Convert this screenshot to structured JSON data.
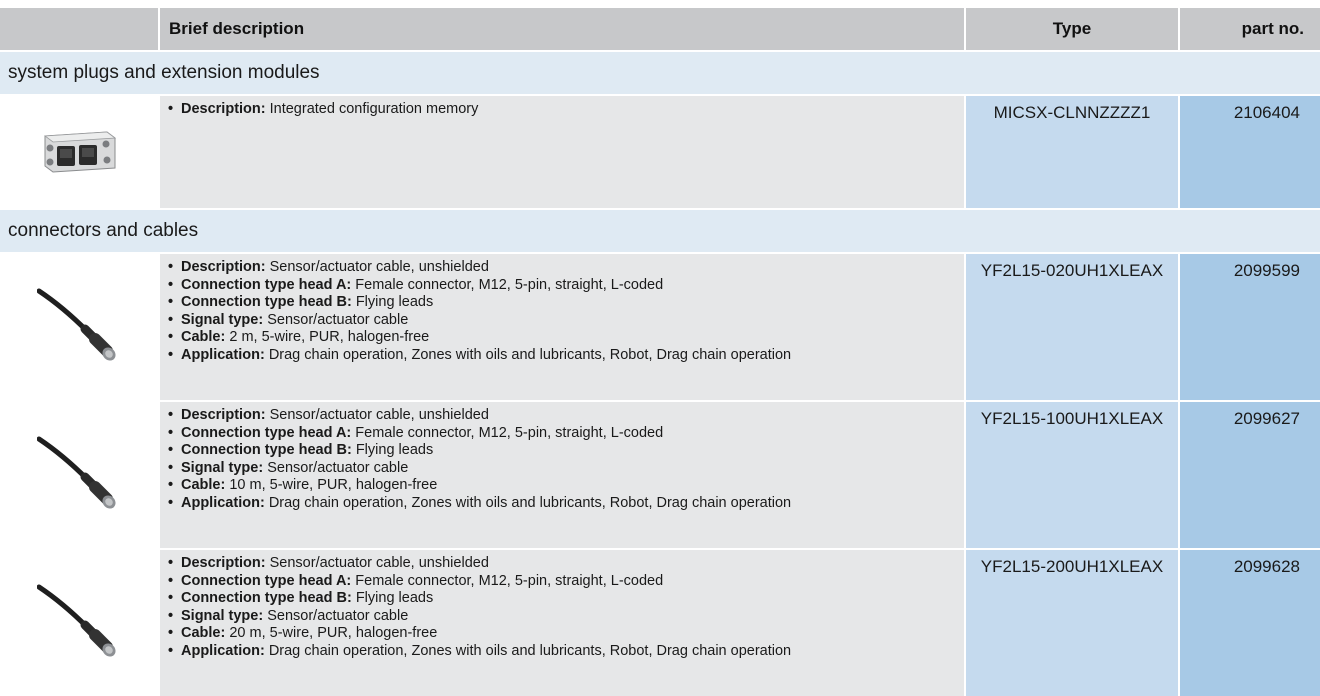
{
  "table": {
    "columns": {
      "brief_description": "Brief description",
      "type": "Type",
      "part_no": "part no."
    },
    "groups": [
      {
        "title": "system plugs and extension modules",
        "items": [
          {
            "image": "system-plug-module-image",
            "features": [
              {
                "label": "Description:",
                "value": "Integrated configuration memory"
              }
            ],
            "type": "MICSX-CLNNZZZZ1",
            "part_no": "2106404"
          }
        ]
      },
      {
        "title": "connectors and cables",
        "items": [
          {
            "image": "cable-connector-image",
            "features": [
              {
                "label": "Description:",
                "value": "Sensor/actuator cable, unshielded"
              },
              {
                "label": "Connection type head A:",
                "value": "Female connector, M12, 5-pin, straight, L-coded"
              },
              {
                "label": "Connection type head B:",
                "value": "Flying leads"
              },
              {
                "label": "Signal type:",
                "value": "Sensor/actuator cable"
              },
              {
                "label": "Cable:",
                "value": "2 m, 5-wire, PUR, halogen-free"
              },
              {
                "label": "Application:",
                "value": "Drag chain operation, Zones with oils and lubricants, Robot, Drag chain operation"
              }
            ],
            "type": "YF2L15-020UH1XLEAX",
            "part_no": "2099599"
          },
          {
            "image": "cable-connector-image",
            "features": [
              {
                "label": "Description:",
                "value": "Sensor/actuator cable, unshielded"
              },
              {
                "label": "Connection type head A:",
                "value": "Female connector, M12, 5-pin, straight, L-coded"
              },
              {
                "label": "Connection type head B:",
                "value": "Flying leads"
              },
              {
                "label": "Signal type:",
                "value": "Sensor/actuator cable"
              },
              {
                "label": "Cable:",
                "value": "10 m, 5-wire, PUR, halogen-free"
              },
              {
                "label": "Application:",
                "value": "Drag chain operation, Zones with oils and lubricants, Robot, Drag chain operation"
              }
            ],
            "type": "YF2L15-100UH1XLEAX",
            "part_no": "2099627"
          },
          {
            "image": "cable-connector-image",
            "features": [
              {
                "label": "Description:",
                "value": "Sensor/actuator cable, unshielded"
              },
              {
                "label": "Connection type head A:",
                "value": "Female connector, M12, 5-pin, straight, L-coded"
              },
              {
                "label": "Connection type head B:",
                "value": "Flying leads"
              },
              {
                "label": "Signal type:",
                "value": "Sensor/actuator cable"
              },
              {
                "label": "Cable:",
                "value": "20 m, 5-wire, PUR, halogen-free"
              },
              {
                "label": "Application:",
                "value": "Drag chain operation, Zones with oils and lubricants, Robot, Drag chain operation"
              }
            ],
            "type": "YF2L15-200UH1XLEAX",
            "part_no": "2099628"
          }
        ]
      }
    ]
  },
  "colors": {
    "header_bg": "#c7c8ca",
    "group_bg": "#dfeaf3",
    "description_bg": "#e6e7e8",
    "type_bg": "#c5daee",
    "part_bg": "#a7c9e6"
  }
}
